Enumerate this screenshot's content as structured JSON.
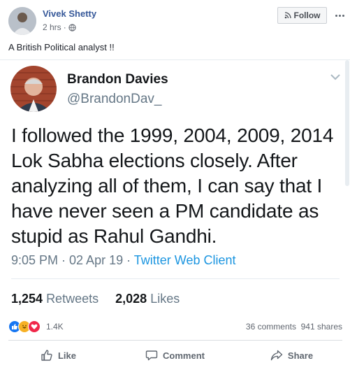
{
  "post": {
    "author": "Vivek Shetty",
    "time": "2 hrs",
    "separator": "·",
    "follow_label": "Follow",
    "caption": "A British Political analyst !!"
  },
  "tweet": {
    "name": "Brandon Davies",
    "handle": "@BrandonDav_",
    "text": "I followed the 1999, 2004, 2009, 2014 Lok Sabha elections closely. After analyzing all of them, I can say that I have never seen a PM candidate as stupid as Rahul Gandhi.",
    "time": "9:05 PM · 02 Apr 19 · ",
    "client": "Twitter Web Client",
    "retweets_count": "1,254",
    "retweets_label": "Retweets",
    "likes_count": "2,028",
    "likes_label": "Likes"
  },
  "reactions": {
    "count": "1.4K",
    "comments": "36 comments",
    "shares": "941 shares",
    "icons": [
      "like-icon",
      "haha-icon",
      "love-icon"
    ]
  },
  "actions": {
    "like": "Like",
    "comment": "Comment",
    "share": "Share"
  },
  "colors": {
    "facebook_link": "#365899",
    "twitter_blue": "#1b95e0",
    "muted": "#657786"
  }
}
